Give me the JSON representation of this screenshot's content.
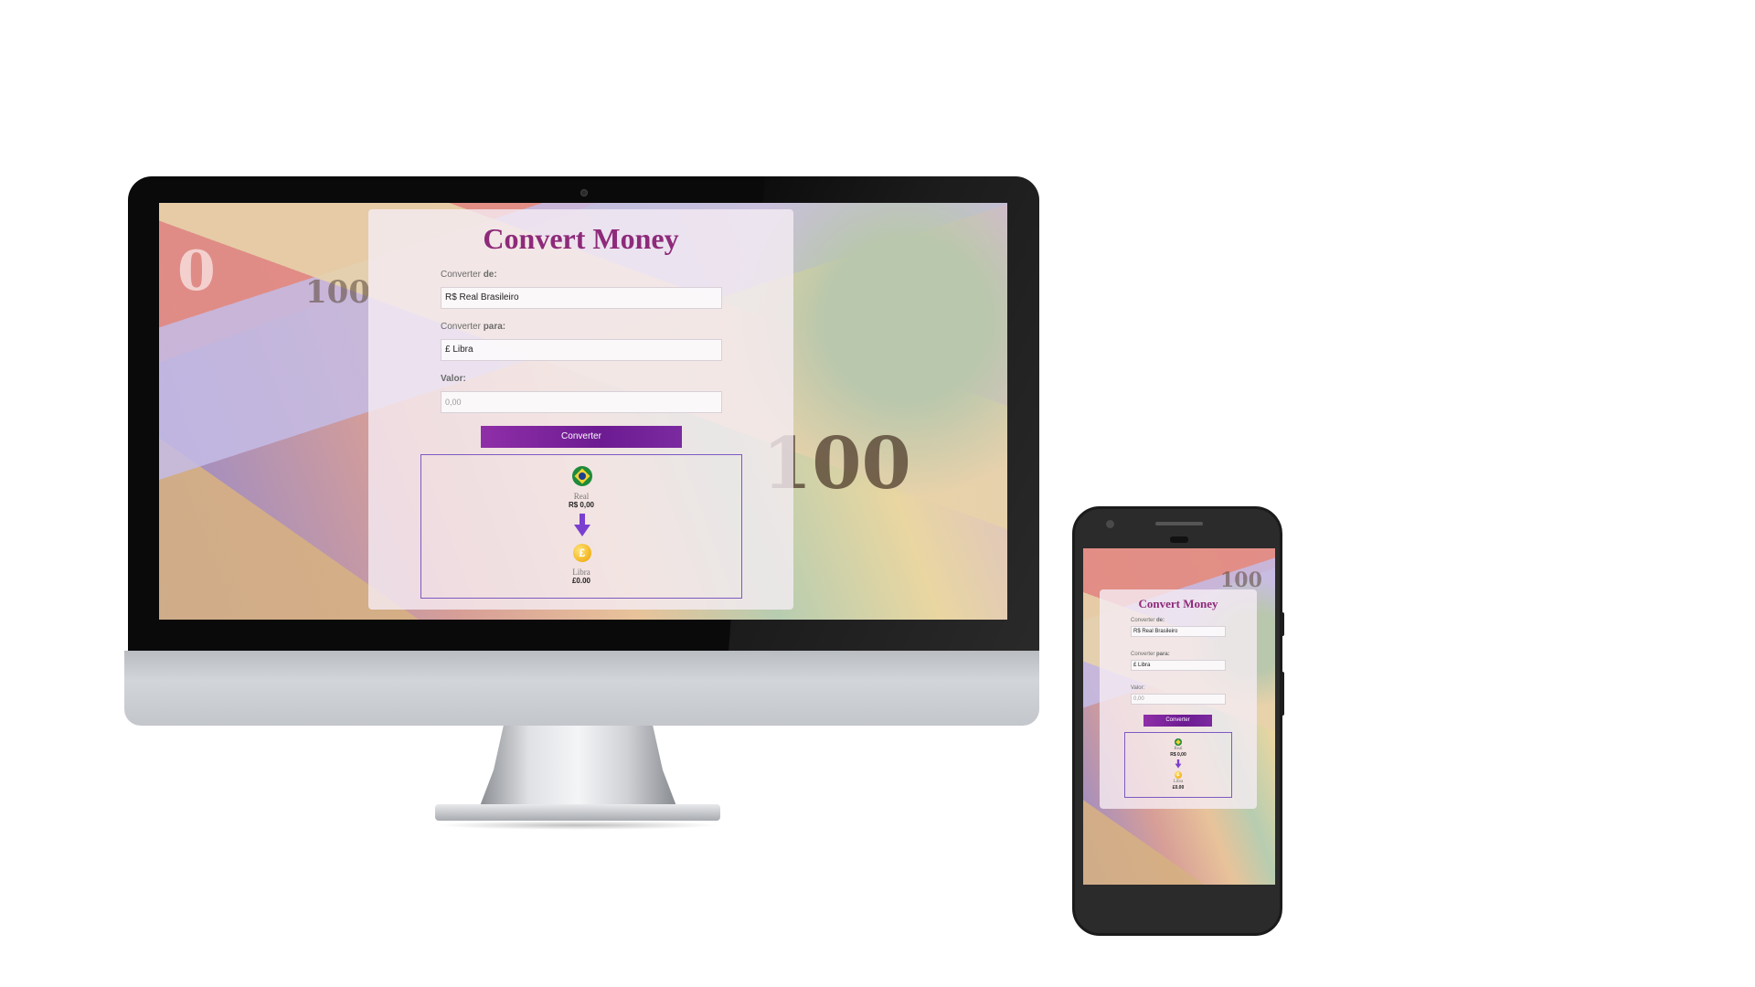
{
  "app": {
    "title": "Convert Money",
    "from_label_prefix": "Converter ",
    "from_label_bold": "de:",
    "from_value": "R$ Real Brasileiro",
    "to_label_prefix": "Converter ",
    "to_label_bold": "para:",
    "to_value": "£ Libra",
    "amount_label": "Valor:",
    "amount_placeholder": "0,00",
    "convert_button": "Converter",
    "result": {
      "from_currency_name": "Real",
      "from_amount": "R$ 0,00",
      "to_currency_name": "Libra",
      "to_amount": "£0.00"
    }
  },
  "icons": {
    "from_flag": "brazil-flag-icon",
    "arrow": "arrow-down-icon",
    "to_coin": "pound-coin-icon",
    "coin_symbol": "£"
  },
  "colors": {
    "title": "#8e2a7a",
    "button": "#7b2aa0",
    "result_border": "#7d5ac1",
    "arrow": "#7b3fd0"
  }
}
